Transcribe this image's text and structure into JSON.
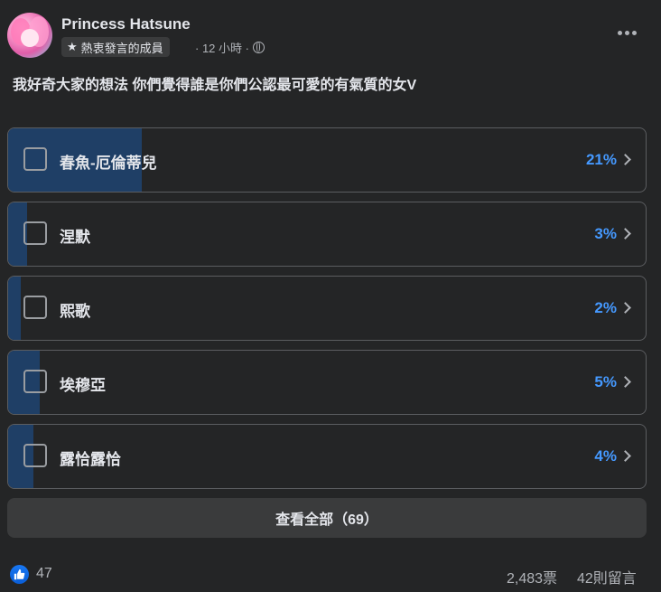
{
  "post": {
    "author": "Princess Hatsune",
    "badge": "熱衷發言的成員",
    "time": "· 12 小時 ·",
    "question": "我好奇大家的想法 你們覺得誰是你們公認最可愛的有氣質的女V"
  },
  "poll": {
    "options": [
      {
        "label": "春魚-厄倫蒂兒",
        "percent_text": "21%",
        "percent": 21
      },
      {
        "label": "涅默",
        "percent_text": "3%",
        "percent": 3
      },
      {
        "label": "熙歌",
        "percent_text": "2%",
        "percent": 2
      },
      {
        "label": "埃穆亞",
        "percent_text": "5%",
        "percent": 5
      },
      {
        "label": "露恰露恰",
        "percent_text": "4%",
        "percent": 4
      }
    ],
    "see_all_label": "查看全部（69）"
  },
  "footer": {
    "like_count": "47",
    "votes": "2,483票",
    "comments": "42則留言"
  },
  "colors": {
    "background": "#242526",
    "bar_fill": "#1f3f66",
    "percent": "#4599ff",
    "like": "#1877f2"
  },
  "icons": [
    "star-icon",
    "globe-icon",
    "more-icon",
    "chevron-right-icon",
    "thumbs-up-icon"
  ]
}
